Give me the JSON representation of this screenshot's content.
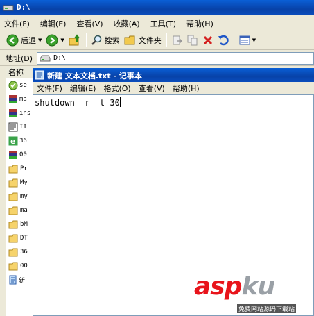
{
  "explorer": {
    "title": "D:\\",
    "menu": [
      "文件(F)",
      "编辑(E)",
      "查看(V)",
      "收藏(A)",
      "工具(T)",
      "帮助(H)"
    ],
    "toolbar": {
      "back_label": "后退",
      "search_label": "搜索",
      "folders_label": "文件夹"
    },
    "address": {
      "label": "地址(D)",
      "value": "D:\\"
    },
    "filelist": {
      "header": "名称",
      "items": [
        {
          "label": "se",
          "icon": "setup-icon"
        },
        {
          "label": "ma",
          "icon": "archive-icon"
        },
        {
          "label": "ins",
          "icon": "archive-icon"
        },
        {
          "label": "II",
          "icon": "document-icon"
        },
        {
          "label": "36",
          "icon": "ie-icon"
        },
        {
          "label": "00",
          "icon": "archive-icon"
        },
        {
          "label": "Pr",
          "icon": "folder-icon"
        },
        {
          "label": "My",
          "icon": "folder-icon"
        },
        {
          "label": "my",
          "icon": "folder-icon"
        },
        {
          "label": "ma",
          "icon": "folder-icon"
        },
        {
          "label": "bM",
          "icon": "folder-icon"
        },
        {
          "label": "DT",
          "icon": "folder-icon"
        },
        {
          "label": "36",
          "icon": "folder-icon"
        },
        {
          "label": "00",
          "icon": "folder-icon"
        },
        {
          "label": "新",
          "icon": "text-file-icon"
        }
      ]
    }
  },
  "notepad": {
    "title": "新建 文本文档.txt - 记事本",
    "menu": [
      "文件(F)",
      "编辑(E)",
      "格式(O)",
      "查看(V)",
      "帮助(H)"
    ],
    "content": "shutdown -r -t 30"
  },
  "watermark": {
    "logo_main": "asp",
    "logo_tail": "ku",
    "subtitle": "免费网站源码下载站"
  },
  "colors": {
    "titlebar": "#0a52c4",
    "chrome": "#ece9d8",
    "logo_red": "#e8141b"
  }
}
